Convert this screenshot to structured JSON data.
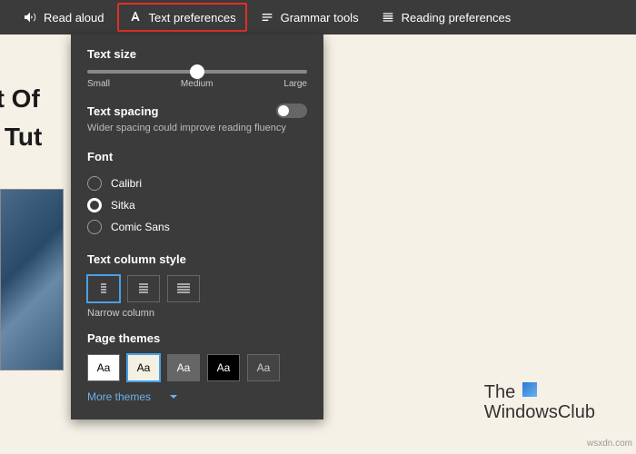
{
  "toolbar": {
    "read_aloud": "Read aloud",
    "text_prefs": "Text preferences",
    "grammar": "Grammar tools",
    "reading_prefs": "Reading preferences"
  },
  "page": {
    "line1": "st Of",
    "line2": "o Tut"
  },
  "panel": {
    "text_size_label": "Text size",
    "slider": {
      "small": "Small",
      "medium": "Medium",
      "large": "Large"
    },
    "text_spacing_label": "Text spacing",
    "text_spacing_desc": "Wider spacing could improve reading fluency",
    "font_label": "Font",
    "fonts": [
      "Calibri",
      "Sitka",
      "Comic Sans"
    ],
    "font_selected": 1,
    "column_label": "Text column style",
    "column_caption": "Narrow column",
    "themes_label": "Page themes",
    "themes": [
      {
        "label": "Aa",
        "bg": "#ffffff",
        "fg": "#000000"
      },
      {
        "label": "Aa",
        "bg": "#f5f1e2",
        "fg": "#000000"
      },
      {
        "label": "Aa",
        "bg": "#666666",
        "fg": "#ffffff"
      },
      {
        "label": "Aa",
        "bg": "#000000",
        "fg": "#ffffff"
      },
      {
        "label": "Aa",
        "bg": "#444444",
        "fg": "#cccccc"
      }
    ],
    "themes_selected": 1,
    "more_themes": "More themes"
  },
  "brand": {
    "line1": "The",
    "line2": "WindowsClub"
  },
  "watermark": "wsxdn.com"
}
